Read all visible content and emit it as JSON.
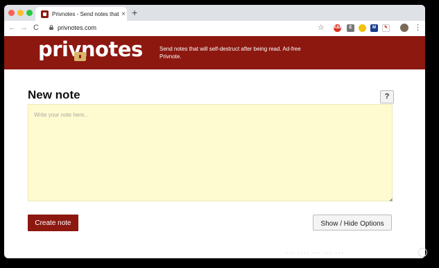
{
  "browser": {
    "tab_title": "Privnotes - Send notes that wi",
    "tab_close": "×",
    "new_tab": "+",
    "url": "privnotes.com",
    "nav_back": "←",
    "nav_forward": "→",
    "nav_reload": "C",
    "star": "☆",
    "menu": "⋮",
    "extensions": [
      "ABP",
      "E",
      "",
      "M",
      "✎"
    ]
  },
  "site": {
    "logo_text": "privnotes",
    "tagline": "Send notes that will self-destruct after being read. Ad-free Privnote.",
    "colors": {
      "brand": "#8c1810",
      "note_bg": "#fffbd0"
    }
  },
  "main": {
    "title": "New note",
    "help_label": "?",
    "note_placeholder": "Write your note here...",
    "resize_handle": "◢",
    "create_button": "Create note",
    "options_button": "Show / Hide Options"
  },
  "overlay": {
    "watermark": "··· ···· ··· ··· ···"
  }
}
